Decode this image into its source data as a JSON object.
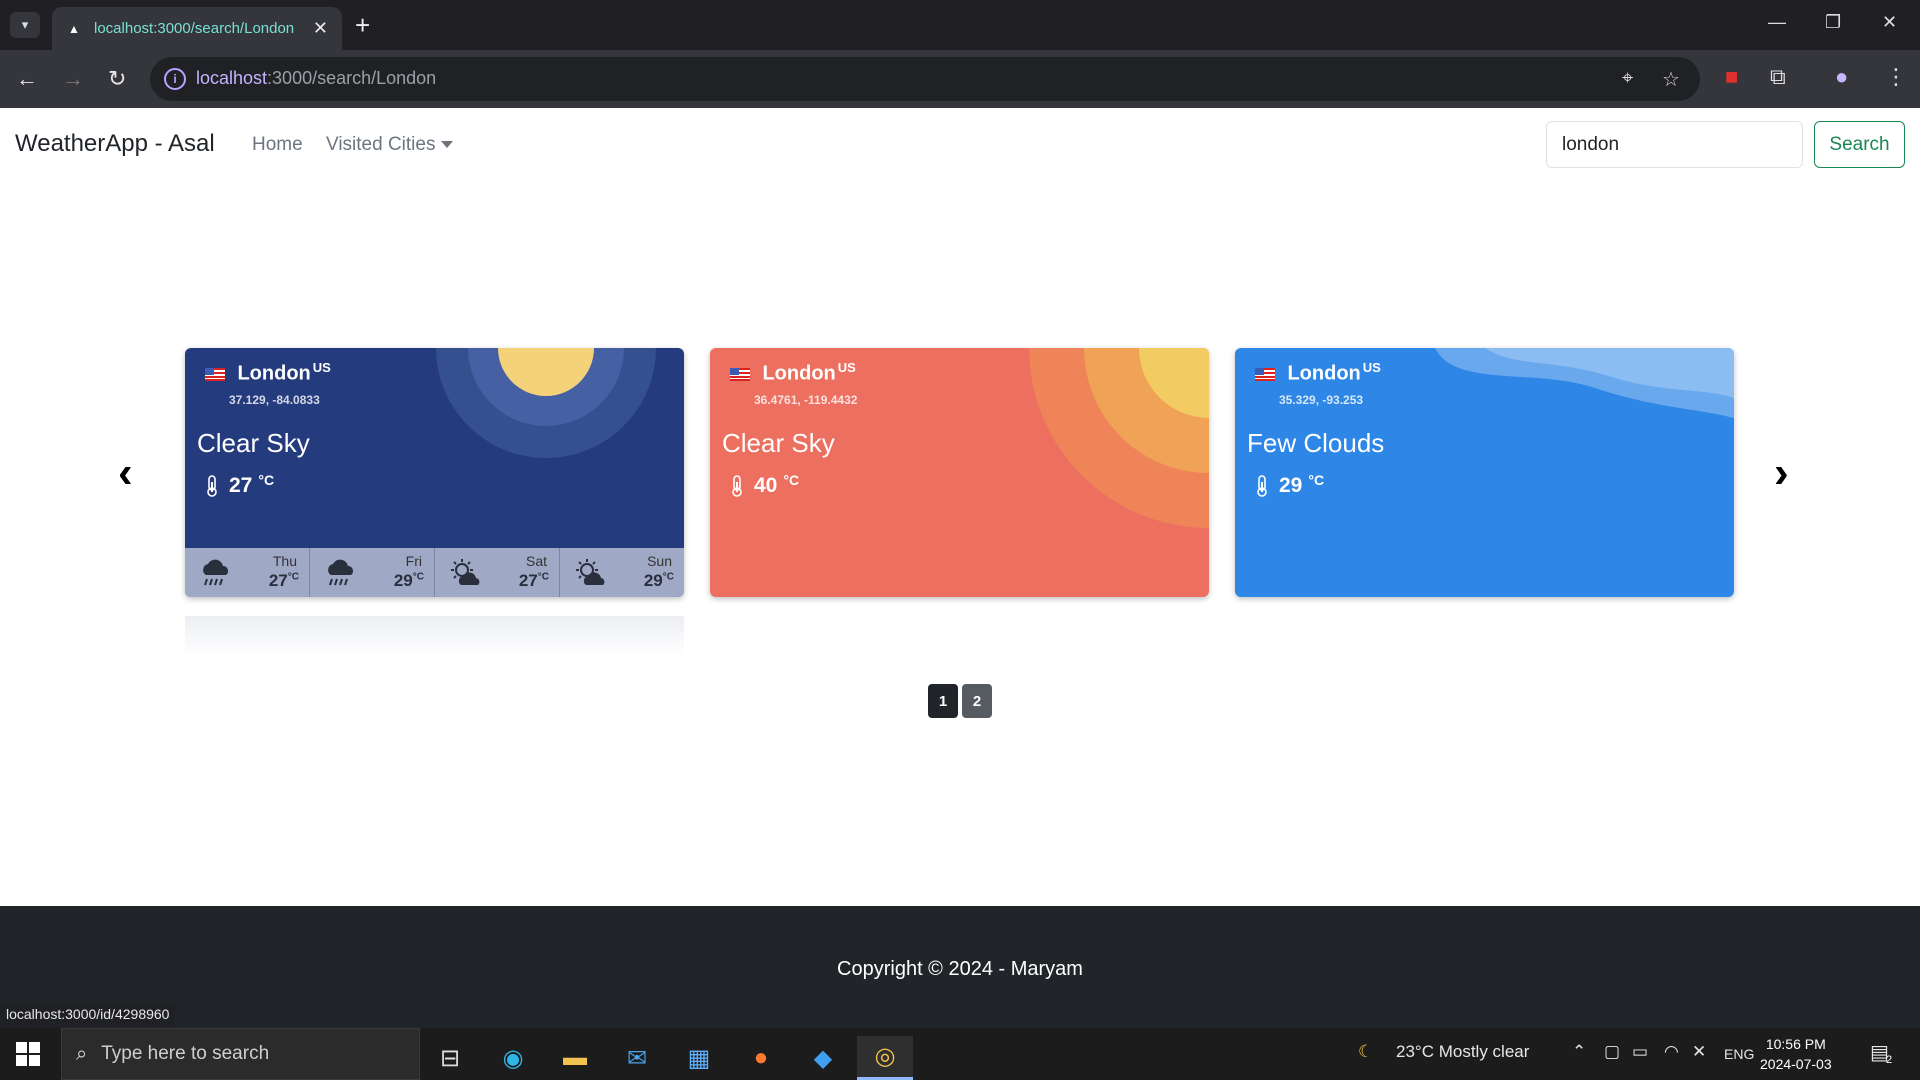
{
  "browser": {
    "tab_title": "localhost:3000/search/London",
    "url_host": "localhost",
    "url_rest": ":3000/search/London",
    "status_url": "localhost:3000/id/4298960"
  },
  "navbar": {
    "brand": "WeatherApp - Asal",
    "home": "Home",
    "visited": "Visited Cities",
    "search_value": "london",
    "search_button": "Search"
  },
  "cards": [
    {
      "city": "London",
      "country": "US",
      "coords": "37.129, -84.0833",
      "condition": "Clear Sky",
      "temp": "27",
      "unit": "°C",
      "theme": "#243b7e",
      "forecast": [
        {
          "day": "Thu",
          "temp": "27",
          "icon": "rain-cloud-icon"
        },
        {
          "day": "Fri",
          "temp": "29",
          "icon": "rain-cloud-icon"
        },
        {
          "day": "Sat",
          "temp": "27",
          "icon": "sun-cloud-icon"
        },
        {
          "day": "Sun",
          "temp": "29",
          "icon": "sun-cloud-icon"
        }
      ],
      "forecast_unit": "°C"
    },
    {
      "city": "London",
      "country": "US",
      "coords": "36.4761, -119.4432",
      "condition": "Clear Sky",
      "temp": "40",
      "unit": "°C",
      "theme": "#ec6f5f"
    },
    {
      "city": "London",
      "country": "US",
      "coords": "35.329, -93.253",
      "condition": "Few Clouds",
      "temp": "29",
      "unit": "°C",
      "theme": "#2e87e6"
    }
  ],
  "pagination": [
    "1",
    "2"
  ],
  "footer": "Copyright © 2024 - Maryam",
  "taskbar": {
    "search_placeholder": "Type here to search",
    "weather": "23°C  Mostly clear",
    "lang": "ENG",
    "time": "10:56 PM",
    "date": "2024-07-03",
    "notif_count": "2"
  },
  "colors": {
    "accent_green": "#198754",
    "footer_bg": "#212529"
  }
}
